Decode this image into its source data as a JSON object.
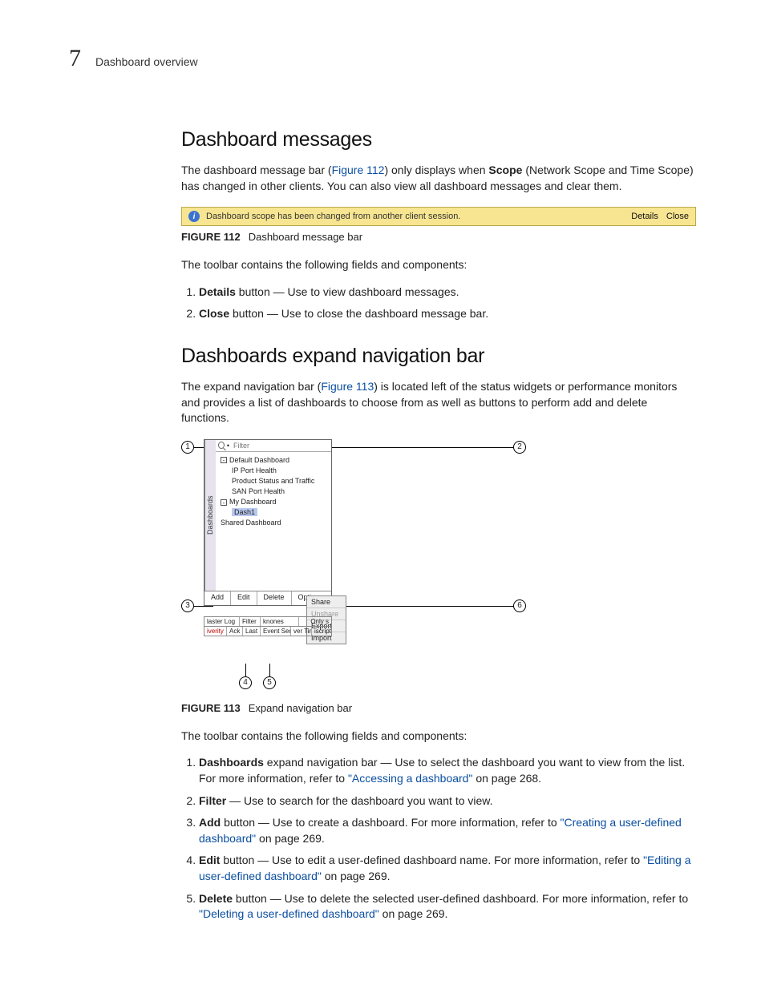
{
  "header": {
    "chapter_number": "7",
    "running_title": "Dashboard overview"
  },
  "s1": {
    "title": "Dashboard messages",
    "p1a": "The dashboard message bar (",
    "p1link": "Figure 112",
    "p1b": ") only displays when ",
    "p1bold": "Scope",
    "p1c": " (Network Scope and Time Scope) has changed in other clients. You can also view all dashboard messages and clear them.",
    "msgbar": {
      "text": "Dashboard scope has been changed from another client session.",
      "details": "Details",
      "close": "Close"
    },
    "fig112_num": "FIGURE 112",
    "fig112_cap": "Dashboard message bar",
    "intro": "The toolbar contains the following fields and components:",
    "items": [
      {
        "bold": "Details",
        "rest": " button — Use to view dashboard messages."
      },
      {
        "bold": "Close",
        "rest": " button — Use to close the dashboard message bar."
      }
    ]
  },
  "s2": {
    "title": "Dashboards expand navigation bar",
    "p1a": "The expand navigation bar (",
    "p1link": "Figure 113",
    "p1b": ") is located left of the status widgets or performance monitors and provides a list of dashboards to choose from as well as buttons to perform add and delete functions.",
    "panel": {
      "tab": "Dashboards",
      "filter_placeholder": "Filter",
      "tree": {
        "default": "Default Dashboard",
        "ip": "IP Port Health",
        "prod": "Product Status and Traffic",
        "san": "SAN Port Health",
        "my": "My Dashboard",
        "dash1": "Dash1",
        "shared": "Shared Dashboard"
      },
      "toolbar": {
        "add": "Add",
        "edit": "Edit",
        "delete": "Delete",
        "options": "Options"
      },
      "options_menu": {
        "share": "Share",
        "unshare": "Unshare",
        "export": "Export",
        "import": "Import"
      },
      "strip1": {
        "a": "laster Log",
        "b": "Filter",
        "c": "knones",
        "d": "Only s"
      },
      "strip2": {
        "a": "iverity",
        "b": "Ack",
        "c": "Last",
        "d": "Event Ser",
        "e": "ver Tim",
        "f": "iscriptic"
      }
    },
    "callouts": {
      "c1": "1",
      "c2": "2",
      "c3": "3",
      "c4": "4",
      "c5": "5",
      "c6": "6"
    },
    "fig113_num": "FIGURE 113",
    "fig113_cap": "Expand navigation bar",
    "intro": "The toolbar contains the following fields and components:",
    "items": {
      "i1_bold": "Dashboards",
      "i1_a": " expand navigation bar — Use to select the dashboard you want to view from the list. For more information, refer to ",
      "i1_link": "\"Accessing a dashboard\"",
      "i1_b": " on page 268.",
      "i2_bold": "Filter",
      "i2_a": " — Use to search for the dashboard you want to view.",
      "i3_bold": "Add",
      "i3_a": " button — Use to create a dashboard. For more information, refer to ",
      "i3_link": "\"Creating a user-defined dashboard\"",
      "i3_b": " on page 269.",
      "i4_bold": "Edit",
      "i4_a": " button — Use to edit a user-defined dashboard name. For more information, refer to ",
      "i4_link": "\"Editing a user-defined dashboard\"",
      "i4_b": " on page 269.",
      "i5_bold": "Delete",
      "i5_a": " button — Use to delete the selected user-defined dashboard. For more information, refer to ",
      "i5_link": "\"Deleting a user-defined dashboard\"",
      "i5_b": " on page 269."
    }
  }
}
